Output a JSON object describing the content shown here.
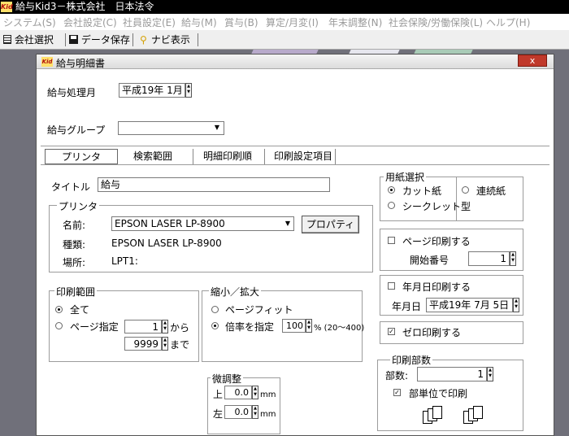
{
  "app": {
    "title": "給与Kid3－株式会社　日本法令",
    "logo": "Kid"
  },
  "menu": [
    "システム(S)",
    "会社設定(C)",
    "社員設定(E)",
    "給与(M)",
    "賞与(B)",
    "算定/月変(I)",
    "年末調整(N)",
    "社会保険/労働保険(L)",
    "ヘルプ(H)"
  ],
  "toolbar": {
    "company_select": "会社選択",
    "save_data": "データ保存",
    "navi": "ナビ表示"
  },
  "dialog": {
    "title": "給与明細書",
    "close_label": "x",
    "month_label": "給与処理月",
    "month_value": "平成19年 1月",
    "group_label": "給与グループ",
    "group_value": "",
    "tabs": [
      "プリンタ",
      "検索範囲",
      "明細印刷順",
      "印刷設定項目"
    ],
    "title_label": "タイトル",
    "title_value": "給与",
    "printer": {
      "group_title": "プリンタ",
      "name_label": "名前:",
      "name_value": "EPSON LASER LP-8900",
      "property_button": "プロパティ",
      "type_label": "種類:",
      "type_value": "EPSON LASER LP-8900",
      "location_label": "場所:",
      "location_value": "LPT1:"
    },
    "print_range": {
      "group_title": "印刷範囲",
      "all_label": "全て",
      "page_label": "ページ指定",
      "from_value": "1",
      "from_suffix": "から",
      "to_value": "9999",
      "to_suffix": "まで"
    },
    "scale": {
      "group_title": "縮小／拡大",
      "fit_label": "ページフィット",
      "ratio_label": "倍率を指定",
      "ratio_value": "100",
      "ratio_range": "% (20～400)"
    },
    "adjust": {
      "group_title": "微調整",
      "top_label": "上",
      "top_value": "0.0",
      "left_label": "左",
      "left_value": "0.0",
      "unit": "mm"
    },
    "paper": {
      "group_title": "用紙選択",
      "cut_label": "カット紙",
      "secret_label": "シークレット型",
      "continuous_label": "連続紙"
    },
    "page_print": {
      "label": "ページ印刷する",
      "start_label": "開始番号",
      "start_value": "1"
    },
    "date_print": {
      "label": "年月日印刷する",
      "date_label": "年月日",
      "date_value": "平成19年 7月 5日"
    },
    "zero_print": {
      "label": "ゼロ印刷する"
    },
    "copies": {
      "group_title": "印刷部数",
      "count_label": "部数:",
      "count_value": "1",
      "collate_label": "部単位で印刷"
    }
  }
}
